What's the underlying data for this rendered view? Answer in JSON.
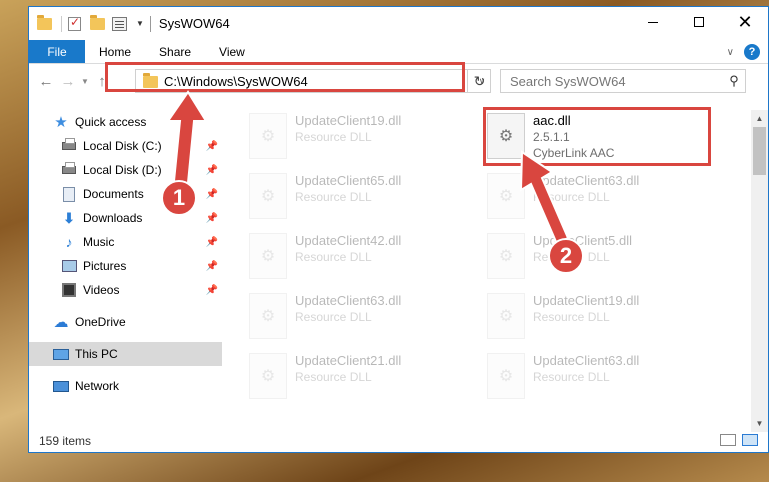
{
  "window": {
    "title": "SysWOW64",
    "minimize_icon": "minimize-icon",
    "maximize_icon": "maximize-icon",
    "close_icon": "close-icon"
  },
  "ribbon": {
    "tabs": [
      "File",
      "Home",
      "Share",
      "View"
    ],
    "accent_color": "#1979ca"
  },
  "address": {
    "path": "C:\\Windows\\SysWOW64"
  },
  "search": {
    "placeholder": "Search SysWOW64"
  },
  "nav_pane": {
    "items": [
      {
        "label": "Quick access",
        "icon": "star-icon",
        "pinned": false
      },
      {
        "label": "Local Disk (C:)",
        "icon": "disk-icon",
        "pinned": true
      },
      {
        "label": "Local Disk (D:)",
        "icon": "disk-icon",
        "pinned": true
      },
      {
        "label": "Documents",
        "icon": "documents-icon",
        "pinned": true
      },
      {
        "label": "Downloads",
        "icon": "downloads-icon",
        "pinned": true
      },
      {
        "label": "Music",
        "icon": "music-icon",
        "pinned": true
      },
      {
        "label": "Pictures",
        "icon": "pictures-icon",
        "pinned": true
      },
      {
        "label": "Videos",
        "icon": "videos-icon",
        "pinned": true
      },
      {
        "label": "OneDrive",
        "icon": "onedrive-icon",
        "pinned": false
      },
      {
        "label": "This PC",
        "icon": "this-pc-icon",
        "pinned": false,
        "selected": true
      },
      {
        "label": "Network",
        "icon": "network-icon",
        "pinned": false
      }
    ]
  },
  "files": {
    "highlighted": {
      "name": "aac.dll",
      "version": "2.5.1.1",
      "description": "CyberLink AAC"
    },
    "background": [
      {
        "name": "UpdateClient19.dll",
        "type": "Resource DLL"
      },
      {
        "name": "UpdateClient65.dll",
        "type": "Resource DLL"
      },
      {
        "name": "UpdateClient63.dll",
        "type": "Resource DLL"
      },
      {
        "name": "UpdateClient42.dll",
        "type": "Resource DLL"
      },
      {
        "name": "UpdateClient5.dll",
        "type": "Resource DLL"
      },
      {
        "name": "UpdateClient63.dll",
        "type": "Resource DLL"
      },
      {
        "name": "UpdateClient19.dll",
        "type": "Resource DLL"
      },
      {
        "name": "UpdateClient21.dll",
        "type": "Resource DLL"
      },
      {
        "name": "UpdateClient63.dll",
        "type": "Resource DLL"
      }
    ]
  },
  "status": {
    "item_count": "159 items"
  },
  "annotations": {
    "callout_1": "1",
    "callout_2": "2",
    "highlight_color": "#d9463f"
  }
}
